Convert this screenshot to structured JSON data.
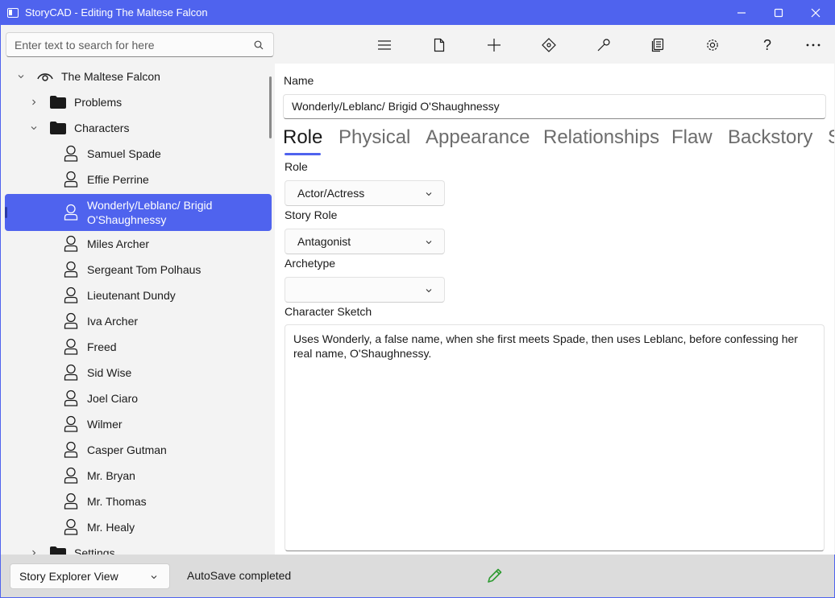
{
  "window": {
    "title": "StoryCAD - Editing The Maltese Falcon"
  },
  "search": {
    "placeholder": "Enter text to search for here"
  },
  "tree": {
    "root": "The Maltese Falcon",
    "problems": "Problems",
    "characters": "Characters",
    "character_items": [
      "Samuel Spade",
      "Effie Perrine",
      "Wonderly/Leblanc/ Brigid O'Shaughnessy",
      "Miles Archer",
      "Sergeant Tom Polhaus",
      "Lieutenant Dundy",
      "Iva Archer",
      "Freed",
      "Sid Wise",
      "Joel Ciaro",
      "Wilmer",
      "Casper Gutman",
      "Mr. Bryan",
      "Mr. Thomas",
      "Mr. Healy"
    ],
    "settings": "Settings",
    "selected_index": 2
  },
  "toolbar": {
    "icons": [
      "menu-icon",
      "new-file-icon",
      "add-icon",
      "move-icon",
      "tools-icon",
      "report-icon",
      "settings-icon",
      "help-icon",
      "more-icon"
    ],
    "help_glyph": "?"
  },
  "form": {
    "name_label": "Name",
    "name_value": "Wonderly/Leblanc/ Brigid O'Shaughnessy",
    "tabs": [
      "Role",
      "Physical",
      "Appearance",
      "Relationships",
      "Flaw",
      "Backstory",
      "S"
    ],
    "active_tab": "Role",
    "role_label": "Role",
    "role_value": "Actor/Actress",
    "story_role_label": "Story Role",
    "story_role_value": "Antagonist",
    "archetype_label": "Archetype",
    "archetype_value": "",
    "sketch_label": "Character Sketch",
    "sketch_value": "Uses Wonderly, a false name, when she first meets Spade, then uses Leblanc, before confessing her real name, O'Shaughnessy."
  },
  "status": {
    "view_selector": "Story Explorer View",
    "autosave": "AutoSave completed",
    "edit_indicator_color": "#2e9b32"
  },
  "colors": {
    "accent": "#4f63ee"
  }
}
